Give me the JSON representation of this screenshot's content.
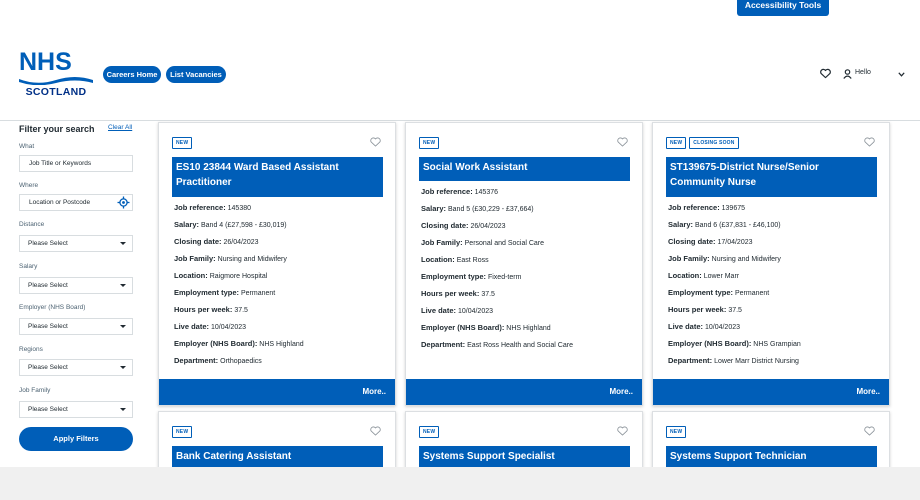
{
  "header": {
    "accessibility_label": "Accessibility Tools",
    "logo_top": "NHS",
    "logo_bottom": "SCOTLAND",
    "nav": [
      "Careers Home",
      "List Vacancies"
    ],
    "hello": "Hello",
    "brand_color": "#005eb8"
  },
  "sidebar": {
    "title": "Filter your search",
    "clear_all": "Clear All",
    "what_label": "What",
    "what_placeholder": "Job Title or Keywords",
    "where_label": "Where",
    "where_placeholder": "Location or Postcode",
    "selects": [
      {
        "label": "Distance",
        "value": "Please Select"
      },
      {
        "label": "Salary",
        "value": "Please Select"
      },
      {
        "label": "Employer (NHS Board)",
        "value": "Please Select"
      },
      {
        "label": "Regions",
        "value": "Please Select"
      },
      {
        "label": "Job Family",
        "value": "Please Select"
      }
    ],
    "apply": "Apply Filters"
  },
  "field_labels": {
    "ref": "Job reference:",
    "salary": "Salary:",
    "closing": "Closing date:",
    "family": "Job Family:",
    "location": "Location:",
    "employment": "Employment type:",
    "hours": "Hours per week:",
    "live": "Live date:",
    "employer": "Employer (NHS Board):",
    "department": "Department:"
  },
  "more_label": "More..",
  "jobs": [
    {
      "badges": [
        "NEW"
      ],
      "title": "ES10 23844 Ward Based Assistant Practitioner",
      "ref": "145380",
      "salary": "Band 4 (£27,598 - £30,019)",
      "closing": "26/04/2023",
      "family": "Nursing and Midwifery",
      "location": "Raigmore Hospital",
      "employment": "Permanent",
      "hours": "37.5",
      "live": "10/04/2023",
      "employer": "NHS Highland",
      "department": "Orthopaedics"
    },
    {
      "badges": [
        "NEW"
      ],
      "title": "Social Work Assistant",
      "ref": "145376",
      "salary": "Band 5 (£30,229 - £37,664)",
      "closing": "26/04/2023",
      "family": "Personal and Social Care",
      "location": "East Ross",
      "employment": "Fixed-term",
      "hours": "37.5",
      "live": "10/04/2023",
      "employer": "NHS Highland",
      "department": "East Ross Health and Social Care"
    },
    {
      "badges": [
        "NEW",
        "CLOSING SOON"
      ],
      "title": "ST139675-District Nurse/Senior Community Nurse",
      "ref": "139675",
      "salary": "Band 6 (£37,831 - £46,100)",
      "closing": "17/04/2023",
      "family": "Nursing and Midwifery",
      "location": "Lower Marr",
      "employment": "Permanent",
      "hours": "37.5",
      "live": "10/04/2023",
      "employer": "NHS Grampian",
      "department": "Lower Marr District Nursing"
    },
    {
      "badges": [
        "NEW"
      ],
      "title": "Bank Catering Assistant"
    },
    {
      "badges": [
        "NEW"
      ],
      "title": "Systems Support Specialist"
    },
    {
      "badges": [
        "NEW"
      ],
      "title": "Systems Support Technician"
    }
  ]
}
